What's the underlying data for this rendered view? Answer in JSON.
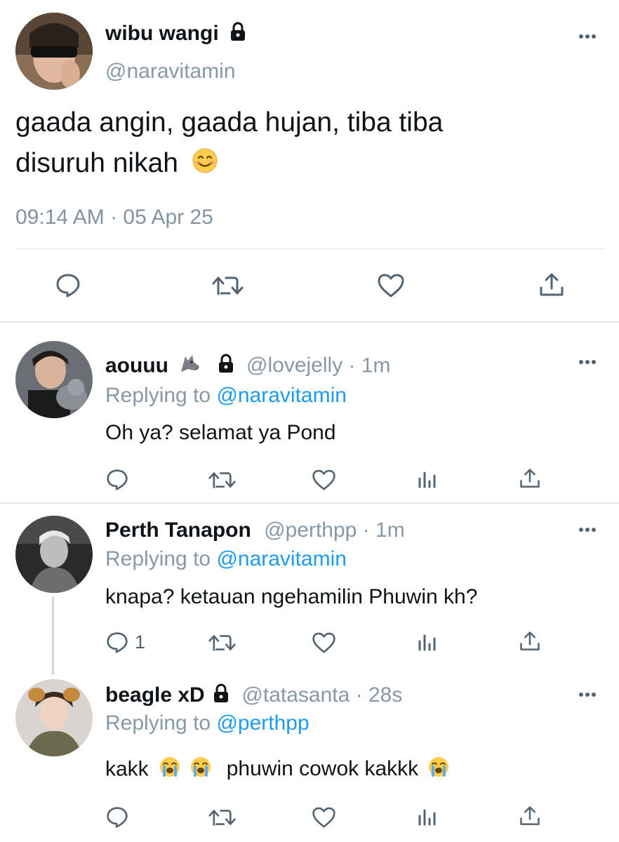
{
  "main_tweet": {
    "display_name": "wibu wangi",
    "handle": "@naravitamin",
    "text_line1": "gaada angin, gaada hujan, tiba tiba",
    "text_line2": "disuruh nikah",
    "timestamp": "09:14 AM · 05 Apr 25",
    "icons": [
      "lock-icon",
      "more-icon",
      "reply-icon",
      "retweet-icon",
      "like-icon",
      "share-icon",
      "smiling-emoji"
    ]
  },
  "replies": [
    {
      "display_name": "aouuu",
      "handle": "@lovejelly",
      "time": "· 1m",
      "replying_prefix": "Replying to",
      "replying_to": "@naravitamin",
      "text": "Oh ya? selamat ya Pond",
      "reply_count": "",
      "icons": [
        "wolf-emoji",
        "lock-icon"
      ]
    },
    {
      "display_name": "Perth Tanapon",
      "handle": "@perthpp",
      "time": "· 1m",
      "replying_prefix": "Replying to",
      "replying_to": "@naravitamin",
      "text": "knapa? ketauan ngehamilin Phuwin kh?",
      "reply_count": "1"
    },
    {
      "display_name": "beagle xD",
      "handle": "@tatasanta",
      "time": "· 28s",
      "replying_prefix": "Replying to",
      "replying_to": "@perthpp",
      "text_part1": "kakk",
      "text_part2": "phuwin cowok kakkk",
      "icons": [
        "lock-icon",
        "loudly-crying-emoji"
      ]
    }
  ],
  "colors": {
    "text": "#0f1419",
    "muted": "#8899a6",
    "link": "#1d9bf0",
    "divider": "#e1e8ed"
  }
}
